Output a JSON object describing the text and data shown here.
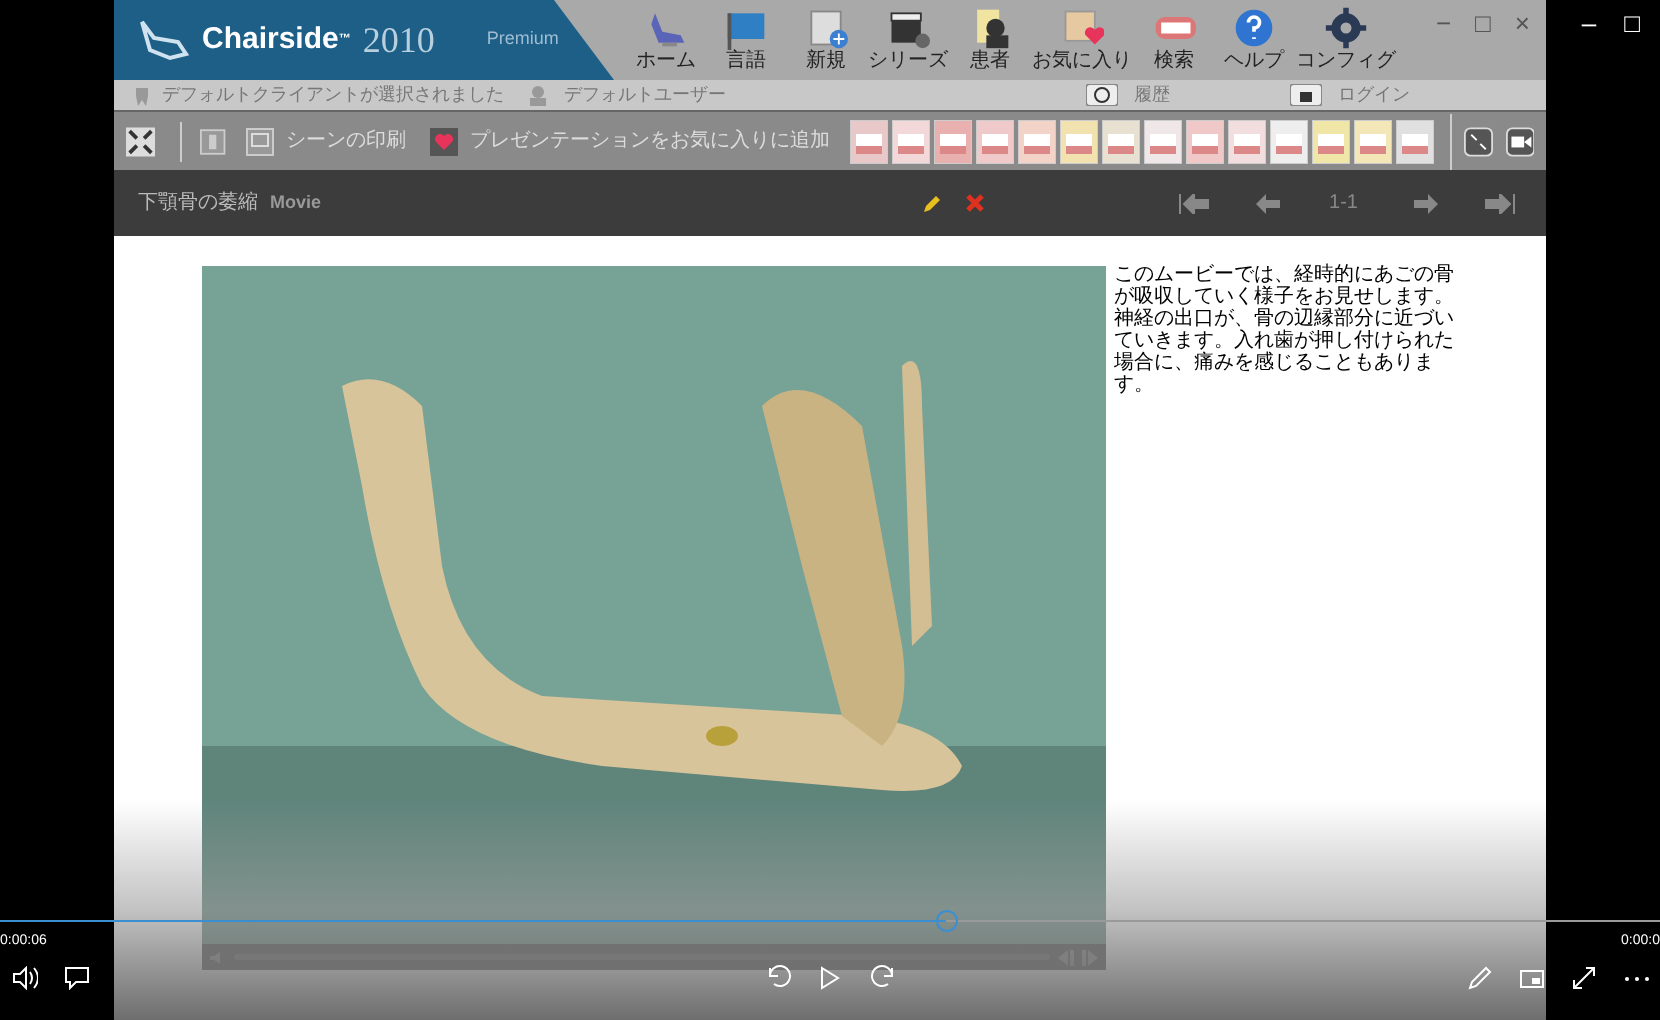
{
  "app": {
    "logo": "Chairside",
    "logo_mark": "™",
    "year": "2010",
    "edition": "Premium"
  },
  "window_controls": [
    "−",
    "□",
    "×"
  ],
  "outer_controls": [
    "–",
    "□"
  ],
  "nav": [
    {
      "label": "ホーム"
    },
    {
      "label": "言語"
    },
    {
      "label": "新規"
    },
    {
      "label": "シリーズ"
    },
    {
      "label": "患者"
    },
    {
      "label": "お気に入り"
    },
    {
      "label": "検索"
    },
    {
      "label": "ヘルプ"
    },
    {
      "label": "コンフィグ"
    }
  ],
  "status_bar": {
    "client": "デフォルトクライアントが選択されました",
    "user": "デフォルトユーザー",
    "history": "履歴",
    "login": "ログイン"
  },
  "toolbar": {
    "print": "シーンの印刷",
    "add_favorite": "プレゼンテーションをお気に入りに追加"
  },
  "scene": {
    "title": "下顎骨の萎縮",
    "type": "Movie",
    "page": "1-1"
  },
  "description": "このムービーでは、経時的にあごの骨が吸収していく様子をお見せします。神経の出口が、骨の辺縁部分に近づいていきます。入れ歯が押し付けられた場合に、痛みを感じることもあります。",
  "player": {
    "level": 0.57,
    "elapsed": "0:00:06",
    "remaining": "0:00:0"
  }
}
